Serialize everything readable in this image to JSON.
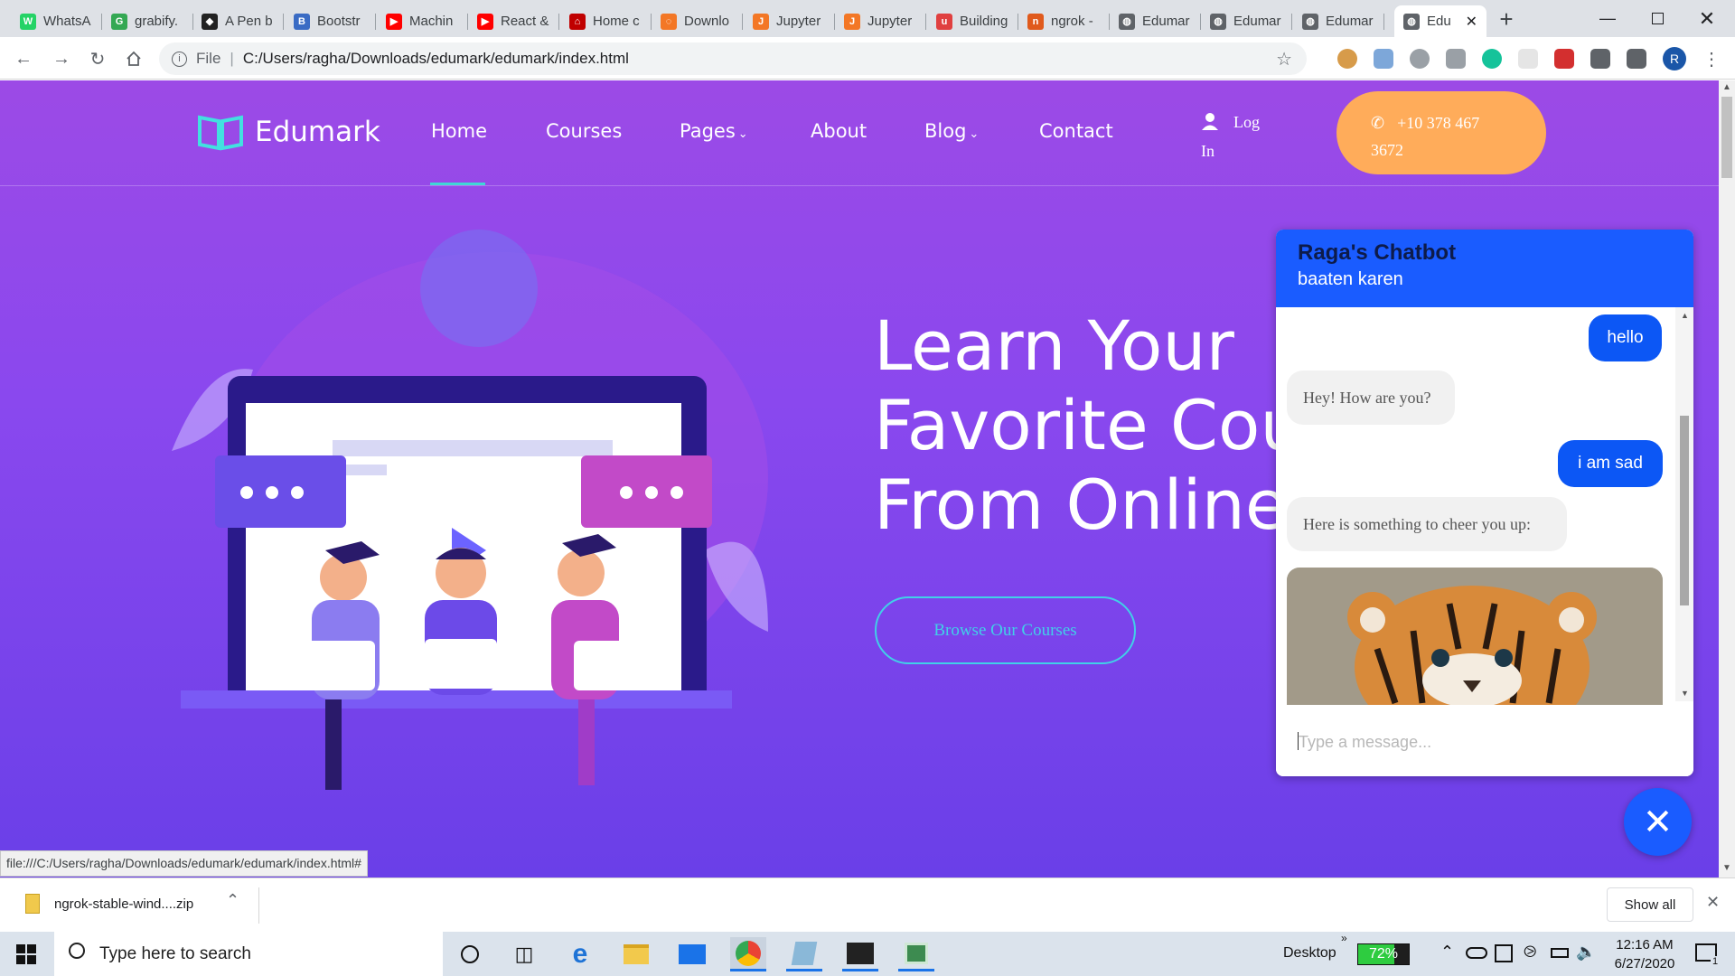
{
  "browser": {
    "tabs": [
      {
        "label": "WhatsA",
        "color": "#25d366",
        "glyph": "W"
      },
      {
        "label": "grabify.",
        "color": "#34a853",
        "glyph": "G"
      },
      {
        "label": "A Pen b",
        "color": "#222222",
        "glyph": "◆"
      },
      {
        "label": "Bootstr",
        "color": "#3a6bc4",
        "glyph": "B"
      },
      {
        "label": "Machin",
        "color": "#ff0000",
        "glyph": "▶"
      },
      {
        "label": "React &",
        "color": "#ff0000",
        "glyph": "▶"
      },
      {
        "label": "Home c",
        "color": "#c00000",
        "glyph": "⌂"
      },
      {
        "label": "Downlo",
        "color": "#f37726",
        "glyph": "◌"
      },
      {
        "label": "Jupyter",
        "color": "#f37726",
        "glyph": "J"
      },
      {
        "label": "Jupyter",
        "color": "#f37726",
        "glyph": "J"
      },
      {
        "label": "Building",
        "color": "#e04040",
        "glyph": "u"
      },
      {
        "label": "ngrok -",
        "color": "#e05a1c",
        "glyph": "n"
      },
      {
        "label": "Edumar",
        "color": "#5f6368",
        "glyph": "◍"
      },
      {
        "label": "Edumar",
        "color": "#5f6368",
        "glyph": "◍"
      },
      {
        "label": "Edumar",
        "color": "#5f6368",
        "glyph": "◍"
      },
      {
        "label": "Edu",
        "color": "#5f6368",
        "glyph": "◍"
      }
    ],
    "address_prefix": "File",
    "address": "C:/Users/ragha/Downloads/edumark/edumark/index.html",
    "profile_initial": "R",
    "status_url": "file:///C:/Users/ragha/Downloads/edumark/edumark/index.html#"
  },
  "site": {
    "logo": "Edumark",
    "nav": [
      "Home",
      "Courses",
      "Pages",
      "About",
      "Blog",
      "Contact"
    ],
    "login_line1": "Log",
    "login_line2": "In",
    "phone_line1": "+10 378 467",
    "phone_line2": "3672",
    "hero_lines": [
      "Learn Your",
      "Favorite Cou",
      "From Online"
    ],
    "browse_button": "Browse Our Courses"
  },
  "chatbot": {
    "title": "Raga's Chatbot",
    "subtitle": "baaten karen",
    "messages": [
      {
        "from": "user",
        "text": "hello"
      },
      {
        "from": "bot",
        "text": "Hey! How are you?"
      },
      {
        "from": "user",
        "text": "i am sad"
      },
      {
        "from": "bot",
        "text": "Here is something to cheer you up:"
      }
    ],
    "input_placeholder": "Type a message..."
  },
  "downloads": {
    "file": "ngrok-stable-wind....zip",
    "show_all": "Show all"
  },
  "taskbar": {
    "search_placeholder": "Type here to search",
    "desktop_label": "Desktop",
    "battery": "72%",
    "time": "12:16 AM",
    "date": "6/27/2020",
    "notification_count": "1"
  }
}
